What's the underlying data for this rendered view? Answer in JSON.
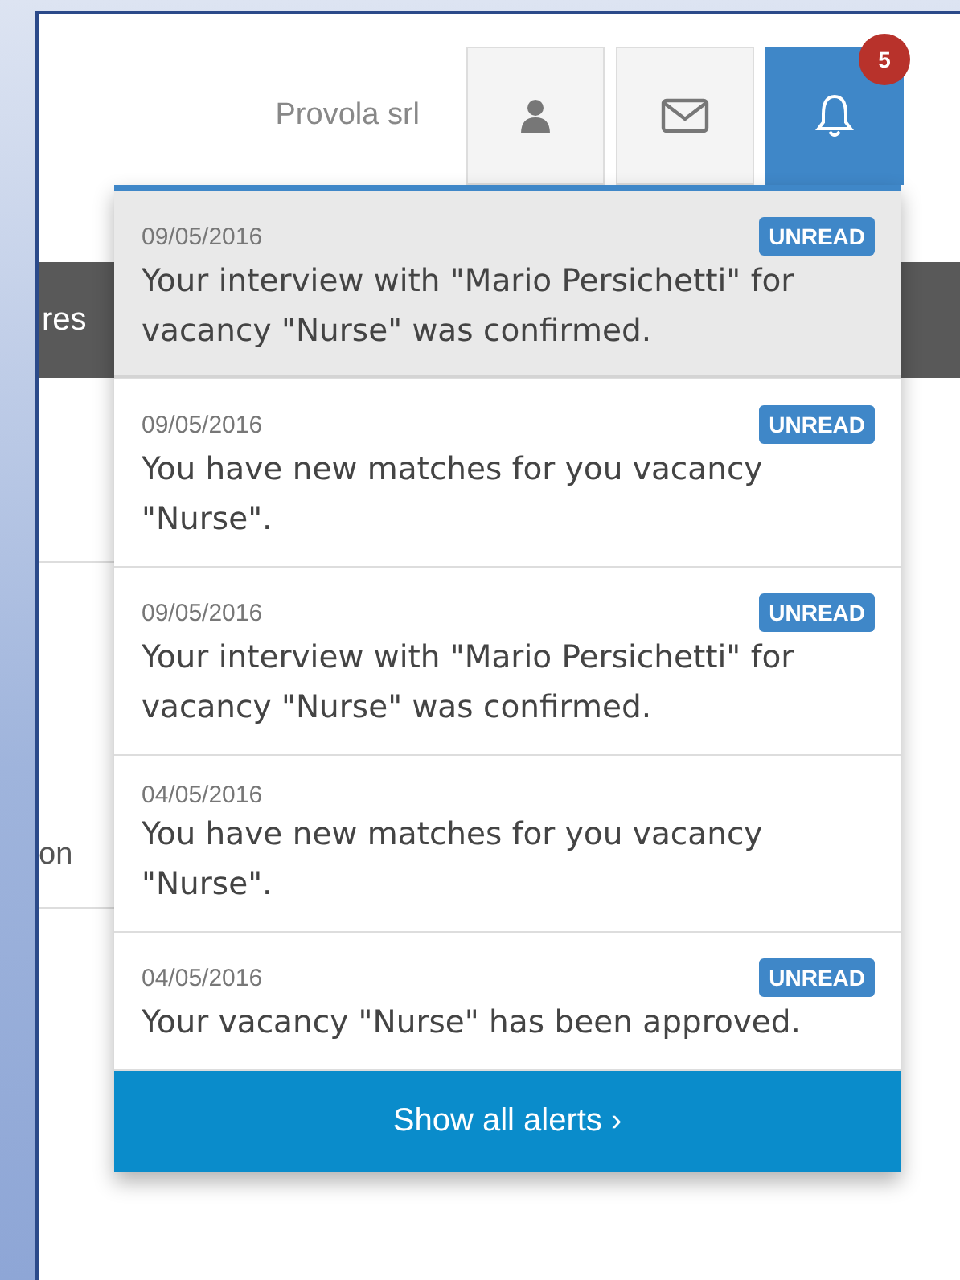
{
  "background_texts": {
    "bar_text": "res",
    "row_text": "on"
  },
  "header": {
    "company": "Provola srl",
    "buttons": [
      {
        "kind": "user",
        "selected": false
      },
      {
        "kind": "mail",
        "selected": false
      },
      {
        "kind": "bell",
        "selected": true,
        "badge": "5"
      }
    ]
  },
  "alerts": [
    {
      "date": "09/05/2016",
      "text": "Your interview with \"Mario Persichetti\" for vacancy \"Nurse\" was confirmed.",
      "badge": "UNREAD",
      "highlighted": true
    },
    {
      "date": "09/05/2016",
      "text": "You have new matches for you vacancy \"Nurse\".",
      "badge": "UNREAD",
      "highlighted": false
    },
    {
      "date": "09/05/2016",
      "text": "Your interview with \"Mario Persichetti\" for vacancy \"Nurse\" was confirmed.",
      "badge": "UNREAD",
      "highlighted": false
    },
    {
      "date": "04/05/2016",
      "text": "You have new matches for you vacancy \"Nurse\".",
      "highlighted": false
    },
    {
      "date": "04/05/2016",
      "text": "Your vacancy \"Nurse\" has been approved.",
      "badge": "UNREAD",
      "highlighted": false
    }
  ],
  "footer": {
    "label": "Show all alerts",
    "arrow": "›"
  }
}
